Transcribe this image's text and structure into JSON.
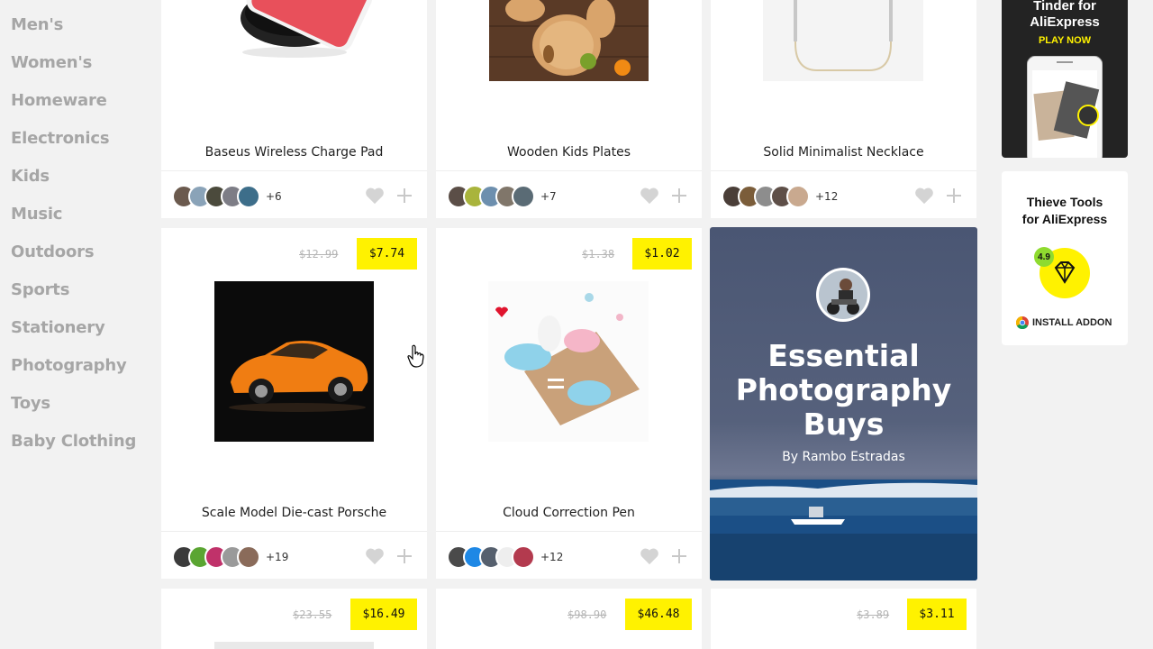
{
  "sidebar": {
    "categories": [
      "Men's",
      "Women's",
      "Homeware",
      "Electronics",
      "Kids",
      "Music",
      "Outdoors",
      "Sports",
      "Stationery",
      "Photography",
      "Toys",
      "Baby Clothing"
    ]
  },
  "products": [
    {
      "title": "Baseus Wireless Charge Pad",
      "more": "+6"
    },
    {
      "title": "Wooden Kids Plates",
      "more": "+7"
    },
    {
      "title": "Solid Minimalist Necklace",
      "more": "+12"
    },
    {
      "title": "Scale Model Die-cast Porsche",
      "more": "+19",
      "old_price": "$12.99",
      "price": "$7.74"
    },
    {
      "title": "Cloud Correction Pen",
      "more": "+12",
      "old_price": "$1.38",
      "price": "$1.02"
    },
    {
      "old_price": "$23.55",
      "price": "$16.49"
    },
    {
      "old_price": "$98.90",
      "price": "$46.48"
    },
    {
      "old_price": "$3.89",
      "price": "$3.11"
    }
  ],
  "feature": {
    "title_lines": [
      "Essential",
      "Photography",
      "Buys"
    ],
    "by": "By Rambo Estradas"
  },
  "ads": {
    "tinder": {
      "line1": "Tinder for",
      "line2": "AliExpress",
      "cta": "PLAY NOW"
    },
    "thieve": {
      "line1": "Thieve Tools",
      "line2": "for AliExpress",
      "rating": "4.9",
      "cta": "INSTALL ADDON"
    }
  },
  "colors": {
    "accent": "#fff200",
    "sidebar_text": "#a6a6a6",
    "background": "#f2f2f2"
  }
}
